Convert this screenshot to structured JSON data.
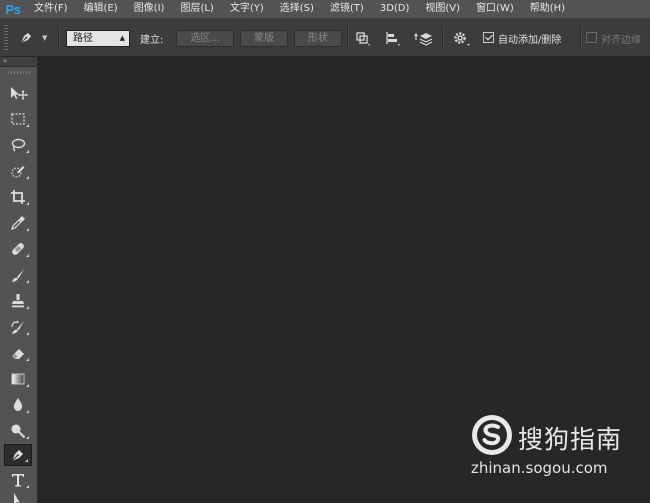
{
  "app": {
    "logo": "Ps",
    "logo_color": "#2fa3ea"
  },
  "menu": [
    "文件(F)",
    "编辑(E)",
    "图像(I)",
    "图层(L)",
    "文字(Y)",
    "选择(S)",
    "滤镜(T)",
    "3D(D)",
    "视图(V)",
    "窗口(W)",
    "帮助(H)"
  ],
  "options": {
    "tool_preset_icon": "pen-icon",
    "mode_select": "路径",
    "make_label": "建立:",
    "selection_button": "选区...",
    "mask_button": "蒙版",
    "shape_button": "形状",
    "path_ops_icon": "path-operations-icon",
    "path_align_icon": "path-alignment-icon",
    "path_arrange_icon": "path-arrangement-icon",
    "settings_icon": "gear-icon",
    "auto_add_delete": {
      "label": "自动添加/删除",
      "checked": true
    },
    "align_edges": {
      "label": "对齐边缘",
      "checked": false
    }
  },
  "toolbar": {
    "collapse": "»",
    "tools": [
      {
        "name": "move-tool",
        "icon": "move-icon"
      },
      {
        "name": "marquee-tool",
        "icon": "rectangular-marquee-icon"
      },
      {
        "name": "lasso-tool",
        "icon": "lasso-icon"
      },
      {
        "name": "quick-selection-tool",
        "icon": "quick-selection-icon"
      },
      {
        "name": "crop-tool",
        "icon": "crop-icon"
      },
      {
        "name": "eyedropper-tool",
        "icon": "eyedropper-icon"
      },
      {
        "name": "healing-brush-tool",
        "icon": "bandage-icon"
      },
      {
        "name": "brush-tool",
        "icon": "brush-icon"
      },
      {
        "name": "clone-stamp-tool",
        "icon": "stamp-icon"
      },
      {
        "name": "history-brush-tool",
        "icon": "history-brush-icon"
      },
      {
        "name": "eraser-tool",
        "icon": "eraser-icon"
      },
      {
        "name": "gradient-tool",
        "icon": "gradient-icon"
      },
      {
        "name": "blur-tool",
        "icon": "drop-icon"
      },
      {
        "name": "dodge-tool",
        "icon": "dodge-icon"
      },
      {
        "name": "pen-tool",
        "icon": "pen-icon",
        "active": true
      },
      {
        "name": "type-tool",
        "icon": "type-icon"
      },
      {
        "name": "path-selection-tool",
        "icon": "arrow-icon"
      }
    ]
  },
  "watermark": {
    "brand": "搜狗指南",
    "url": "zhinan.sogou.com"
  }
}
